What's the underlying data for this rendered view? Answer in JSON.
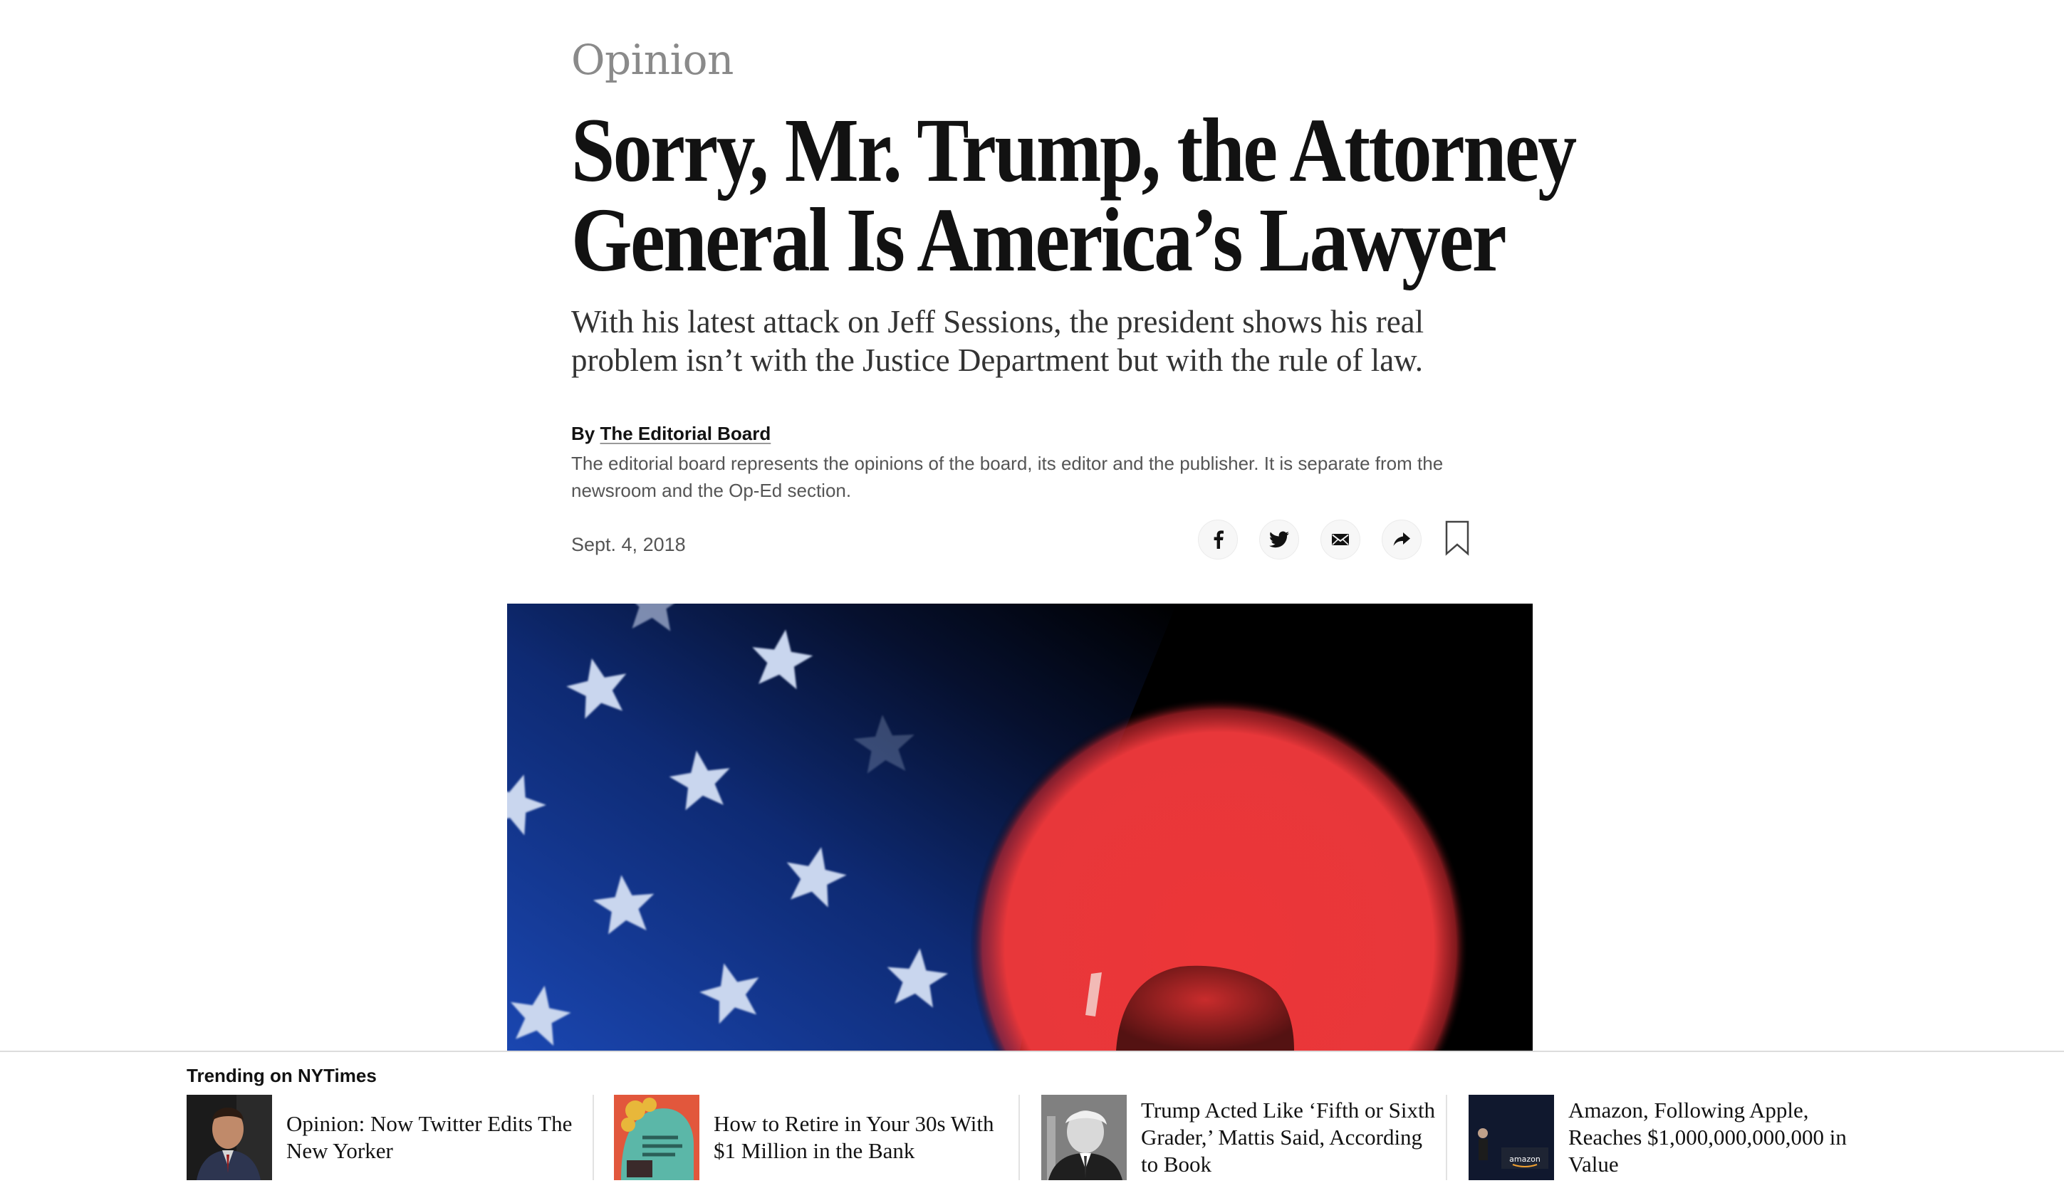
{
  "article": {
    "section": "Opinion",
    "headline_line1": "Sorry, Mr. Trump, the Attorney",
    "headline_line2": "General Is America’s Lawyer",
    "summary": "With his latest attack on Jeff Sessions, the president shows his real problem isn’t with the Justice Department but with the rule of law.",
    "byline_prefix": "By ",
    "byline_author": "The Editorial Board",
    "byline_description": "The editorial board represents the opinions of the board, its editor and the publisher. It is separate from the newsroom and the Op-Ed section.",
    "date": "Sept. 4, 2018"
  },
  "share": {
    "icons": [
      "facebook-icon",
      "twitter-icon",
      "email-icon",
      "share-icon",
      "bookmark-icon"
    ]
  },
  "trending": {
    "title": "Trending on NYTimes",
    "items": [
      {
        "text": "Opinion: Now Twitter Edits The New Yorker"
      },
      {
        "text": "How to Retire in Your 30s With $1 Million in the Bank"
      },
      {
        "text": "Trump Acted Like ‘Fifth or Sixth Grader,’ Mattis Said, According to Book"
      },
      {
        "text": "Amazon, Following Apple, Reaches $1,000,000,000,000 in Value"
      }
    ],
    "thumb_label_amazon": "amazon"
  },
  "colors": {
    "kicker": "#8a8a8a",
    "text": "#121212",
    "muted": "#555555",
    "hero_red": "#e8373a",
    "hero_blue": "#13317a"
  }
}
